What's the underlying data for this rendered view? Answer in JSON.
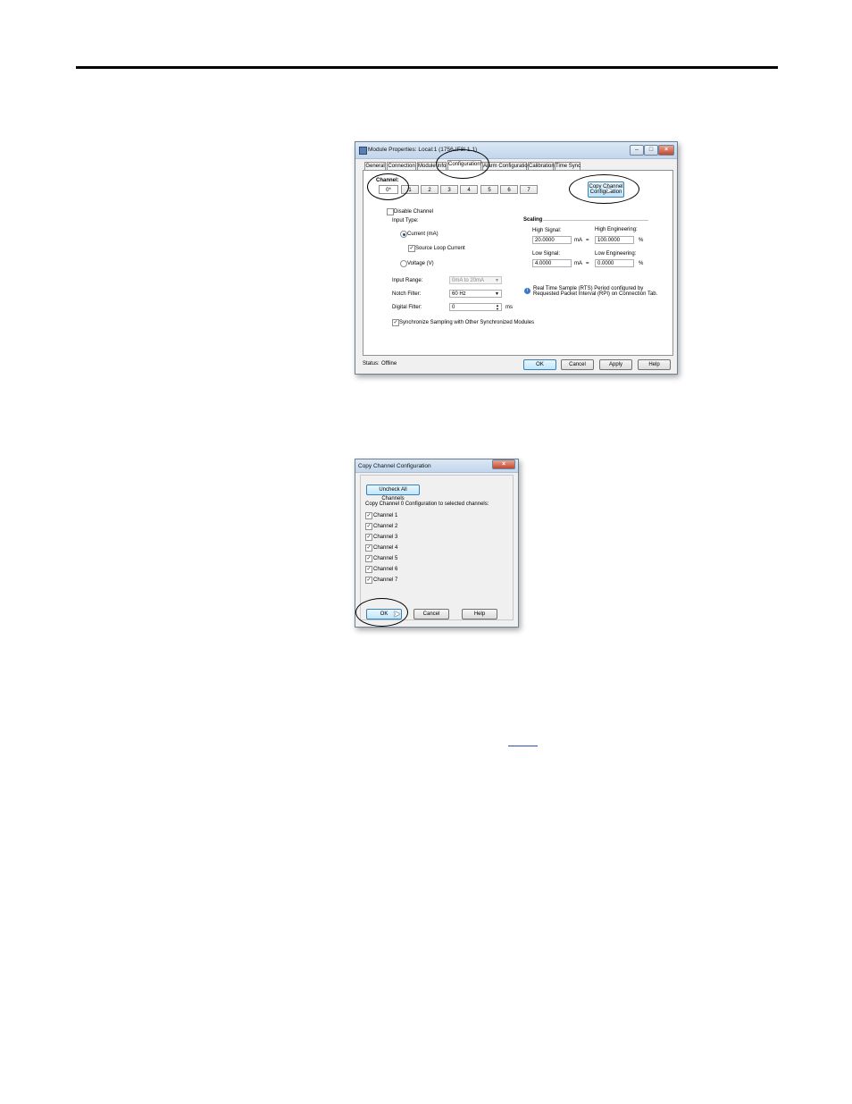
{
  "module_window": {
    "title": "Module Properties: Local:1 (1756-IF8I 1.1)",
    "tabs": [
      {
        "label": "General"
      },
      {
        "label": "Connection"
      },
      {
        "label": "Module Info"
      },
      {
        "label": "Configuration*"
      },
      {
        "label": "Alarm Configuration"
      },
      {
        "label": "Calibration"
      },
      {
        "label": "Time Sync"
      }
    ],
    "channel_label": "Channel:",
    "channels": [
      "0*",
      "1",
      "2",
      "3",
      "4",
      "5",
      "6",
      "7"
    ],
    "copy_channel_button": "Copy Channel Configuration",
    "disable_channel": "Disable Channel",
    "input_type_label": "Input Type:",
    "current_label": "Current (mA)",
    "source_loop_label": "Source Loop Current",
    "voltage_label": "Voltage (V)",
    "input_range_label": "Input Range:",
    "input_range_value": "0mA to 20mA",
    "notch_filter_label": "Notch Filter:",
    "notch_filter_value": "60 Hz",
    "digital_filter_label": "Digital Filter:",
    "digital_filter_value": "0",
    "digital_filter_unit": "ms",
    "sync_label": "Synchronize Sampling with Other Synchronized Modules",
    "scaling_label": "Scaling",
    "high_signal_label": "High Signal:",
    "high_signal_value": "20.0000",
    "high_eng_label": "High Engineering:",
    "high_eng_value": "100.0000",
    "low_signal_label": "Low Signal:",
    "low_signal_value": "4.0000",
    "low_eng_label": "Low Engineering:",
    "low_eng_value": "0.0000",
    "unit_ma": "mA",
    "equals": "=",
    "unit_pct": "%",
    "rts_note_line1": "Real Time Sample (RTS) Period configured by",
    "rts_note_line2": "Requested Packet Interval (RPI) on Connection Tab.",
    "status_label": "Status:",
    "status_value": "Offline",
    "ok": "OK",
    "cancel": "Cancel",
    "apply": "Apply",
    "help": "Help"
  },
  "copy_dialog": {
    "title": "Copy Channel Configuration",
    "uncheck_all": "Uncheck All Channels",
    "instruction": "Copy Channel 0 Configuration to selected channels:",
    "channels": [
      "Channel 1",
      "Channel 2",
      "Channel 3",
      "Channel 4",
      "Channel 5",
      "Channel 6",
      "Channel 7"
    ],
    "ok": "OK",
    "cancel": "Cancel",
    "help": "Help"
  },
  "colors": {
    "titlebar": "#c2d6ec",
    "window_bg": "#f0f0f0",
    "default_button": "#bee6fd",
    "link": "#2a52be"
  }
}
